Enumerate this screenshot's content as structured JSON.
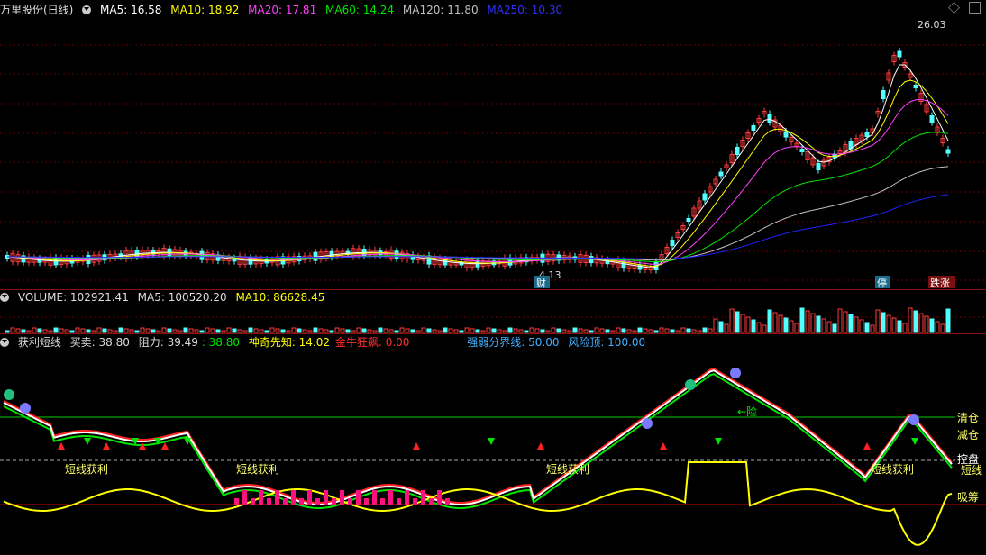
{
  "main_header": {
    "title": "万里股份(日线)",
    "ma5": "MA5: 16.58",
    "ma10": "MA10: 18.92",
    "ma20": "MA20: 17.81",
    "ma60": "MA60: 14.24",
    "ma120": "MA120: 11.80",
    "ma250": "MA250: 10.30"
  },
  "main_chart": {
    "high_label": "26.03",
    "low_label": "4.13",
    "fin_label": "财",
    "stop_label": "停",
    "limit_label": "跌涨"
  },
  "volume_header": {
    "title": "VOLUME: 102921.41",
    "ma5": "MA5: 100520.20",
    "ma10": "MA10: 86628.45"
  },
  "indicator_header": {
    "title": "获利短线",
    "buysell": "买卖: 38.80",
    "resistance": "阻力: 39.49",
    "extra": ": 38.80",
    "foreknow": "神奇先知: 14.02",
    "bull": "金牛狂飙: 0.00",
    "strength": "强弱分界线: 50.00",
    "risk": "风险顶: 100.00"
  },
  "indicator_chart": {
    "short_profit": "短线获利",
    "hint_risk": "←险",
    "lvl_clear": "清仓",
    "lvl_reduce": "减仓",
    "lvl_control": "控盘",
    "lvl_short": "短线",
    "lvl_absorb": "吸筹"
  },
  "colors": {
    "up": "#ff3c3c",
    "down": "#54ffff",
    "ma5": "#ffffff",
    "ma10": "#ffff00",
    "ma20": "#ff40ff",
    "ma60": "#00e600",
    "ma120": "#c0c0c0",
    "ma250": "#2020ff"
  }
}
